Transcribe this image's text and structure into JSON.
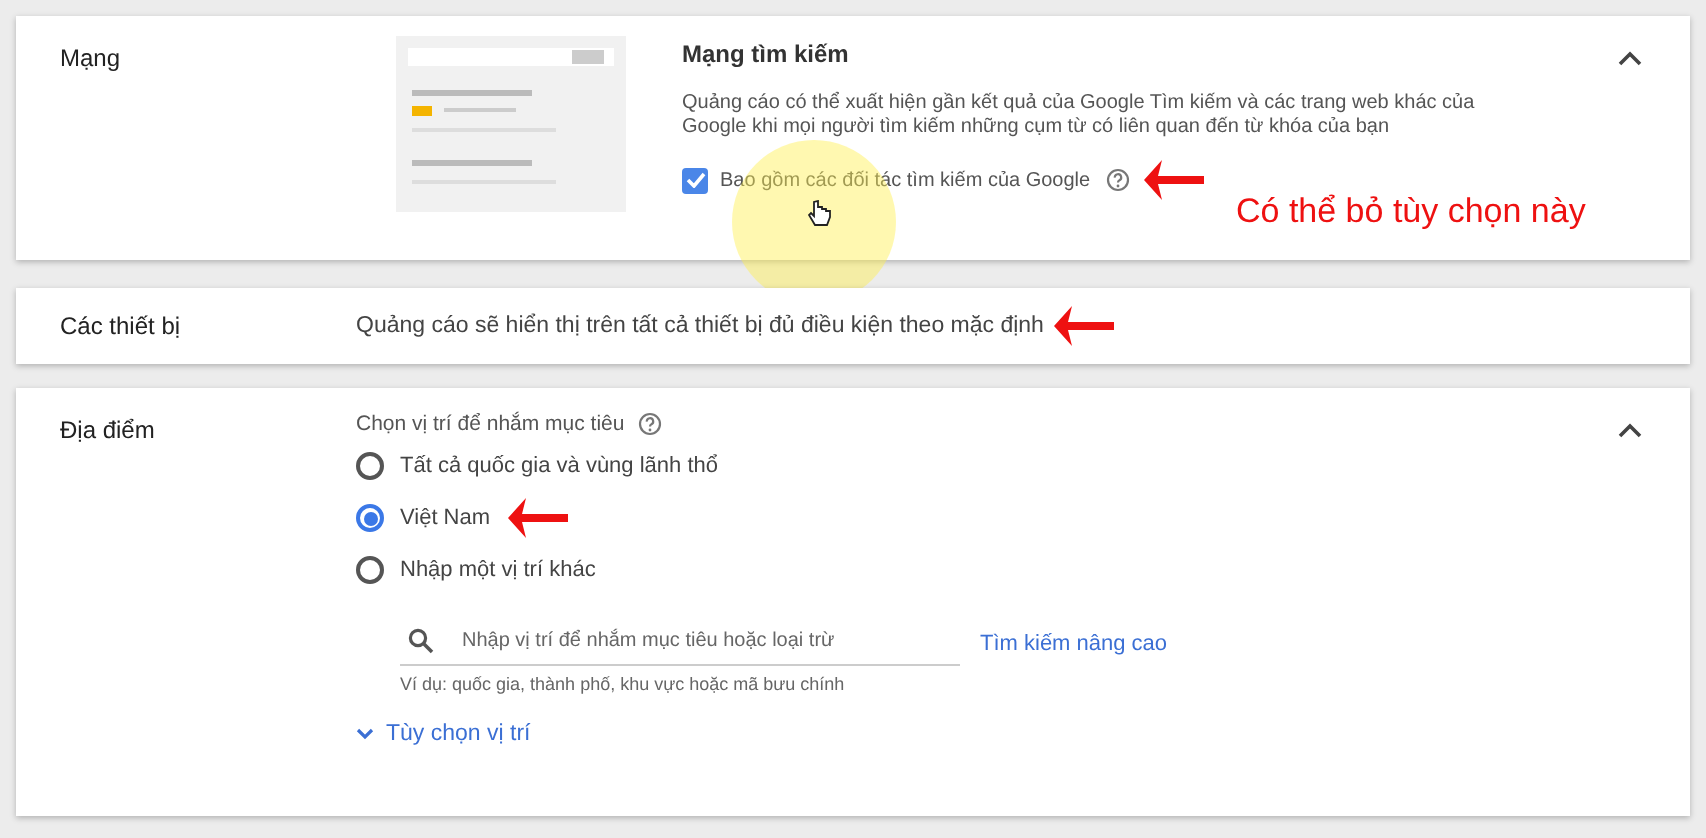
{
  "network": {
    "label": "Mạng",
    "expanded": true,
    "title": "Mạng tìm kiếm",
    "description": "Quảng cáo có thể xuất hiện gần kết quả của Google Tìm kiếm và các trang web khác của Google khi mọi người tìm kiếm những cụm từ có liên quan đến từ khóa của bạn",
    "checkbox": {
      "label": "Bao gồm các đối tác tìm kiếm của Google",
      "checked": true,
      "pointer_arrow": true
    },
    "annotation": "Có thể bỏ tùy chọn này"
  },
  "devices": {
    "label": "Các thiết bị",
    "text": "Quảng cáo sẽ hiển thị trên tất cả thiết bị đủ điều kiện theo mặc định",
    "pointer_arrow": true
  },
  "locations": {
    "label": "Địa điểm",
    "expanded": true,
    "prompt": "Chọn vị trí để nhắm mục tiêu",
    "options": [
      {
        "label": "Tất cả quốc gia và vùng lãnh thổ",
        "selected": false,
        "pointer_arrow": false
      },
      {
        "label": "Việt Nam",
        "selected": true,
        "pointer_arrow": true
      },
      {
        "label": "Nhập một vị trí khác",
        "selected": false,
        "pointer_arrow": false
      }
    ],
    "search": {
      "placeholder": "Nhập vị trí để nhắm mục tiêu hoặc loại trừ",
      "hint": "Ví dụ: quốc gia, thành phố, khu vực hoặc mã bưu chính"
    },
    "advanced_link": "Tìm kiếm nâng cao",
    "options_toggle": "Tùy chọn vị trí"
  }
}
